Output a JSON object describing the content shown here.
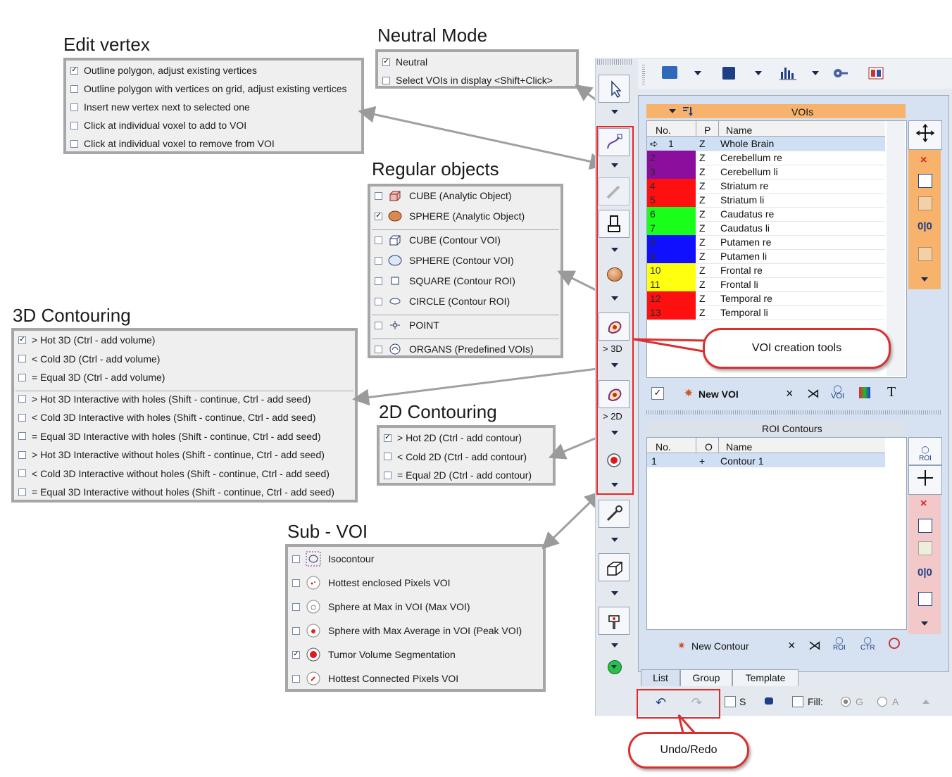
{
  "edit_vertex": {
    "title": "Edit vertex",
    "items": [
      {
        "label": "Outline polygon, adjust existing vertices",
        "checked": true
      },
      {
        "label": "Outline polygon with vertices on grid, adjust existing vertices",
        "checked": false
      },
      {
        "label": "Insert new vertex next to selected one",
        "checked": false
      },
      {
        "label": "Click at individual voxel to add to VOI",
        "checked": false
      },
      {
        "label": "Click at individual voxel to remove from VOI",
        "checked": false
      }
    ]
  },
  "neutral_mode": {
    "title": "Neutral Mode",
    "items": [
      {
        "label": "Neutral",
        "checked": true
      },
      {
        "label": "Select VOIs in display <Shift+Click>",
        "checked": false
      }
    ]
  },
  "regular_objects": {
    "title": "Regular objects",
    "items": [
      {
        "label": "CUBE (Analytic Object)",
        "checked": false,
        "icon": "cube-analytic-icon"
      },
      {
        "label": "SPHERE (Analytic Object)",
        "checked": true,
        "icon": "sphere-analytic-icon"
      },
      {
        "label": "CUBE (Contour VOI)",
        "checked": false,
        "icon": "cube-contour-icon"
      },
      {
        "label": "SPHERE (Contour VOI)",
        "checked": false,
        "icon": "sphere-contour-icon"
      },
      {
        "label": "SQUARE (Contour ROI)",
        "checked": false,
        "icon": "square-icon"
      },
      {
        "label": "CIRCLE (Contour ROI)",
        "checked": false,
        "icon": "circle-icon"
      },
      {
        "label": "POINT",
        "checked": false,
        "icon": "point-icon"
      },
      {
        "label": "ORGANS (Predefined VOIs)",
        "checked": false,
        "icon": "organs-icon"
      }
    ]
  },
  "contouring_3d": {
    "title": "3D Contouring",
    "items": [
      {
        "label": "> Hot 3D (Ctrl - add volume)",
        "checked": true
      },
      {
        "label": "< Cold 3D (Ctrl - add volume)",
        "checked": false
      },
      {
        "label": "= Equal 3D (Ctrl - add volume)",
        "checked": false
      },
      {
        "label": "> Hot 3D Interactive with holes (Shift - continue, Ctrl - add seed)",
        "checked": false
      },
      {
        "label": "< Cold 3D Interactive with holes (Shift - continue, Ctrl - add seed)",
        "checked": false
      },
      {
        "label": "= Equal 3D Interactive with holes (Shift - continue, Ctrl - add seed)",
        "checked": false
      },
      {
        "label": "> Hot 3D Interactive without holes (Shift - continue, Ctrl - add seed)",
        "checked": false
      },
      {
        "label": "< Cold 3D Interactive without holes (Shift - continue, Ctrl - add seed)",
        "checked": false
      },
      {
        "label": "= Equal 3D Interactive without holes (Shift - continue, Ctrl - add seed)",
        "checked": false
      }
    ]
  },
  "contouring_2d": {
    "title": "2D Contouring",
    "items": [
      {
        "label": "> Hot 2D (Ctrl - add contour)",
        "checked": true
      },
      {
        "label": "< Cold 2D (Ctrl - add contour)",
        "checked": false
      },
      {
        "label": "= Equal 2D (Ctrl - add contour)",
        "checked": false
      }
    ]
  },
  "sub_voi": {
    "title": "Sub - VOI",
    "items": [
      {
        "label": "Isocontour",
        "checked": false
      },
      {
        "label": "Hottest enclosed Pixels VOI",
        "checked": false
      },
      {
        "label": "Sphere at Max in VOI (Max VOI)",
        "checked": false
      },
      {
        "label": "Sphere with Max Average in VOI (Peak VOI)",
        "checked": false
      },
      {
        "label": "Tumor Volume Segmentation",
        "checked": true
      },
      {
        "label": "Hottest Connected Pixels VOI",
        "checked": false
      }
    ]
  },
  "toolbar": {
    "label_3d": "> 3D",
    "label_2d": "> 2D"
  },
  "vois": {
    "title": "VOIs",
    "columns": [
      "No.",
      "P",
      "Name"
    ],
    "rows": [
      {
        "no": "1",
        "p": "Z",
        "name": "Whole Brain",
        "color": "#ffffff"
      },
      {
        "no": "2",
        "p": "Z",
        "name": "Cerebellum re",
        "color": "#8b0f9c"
      },
      {
        "no": "3",
        "p": "Z",
        "name": "Cerebellum li",
        "color": "#8b0f9c"
      },
      {
        "no": "4",
        "p": "Z",
        "name": "Striatum re",
        "color": "#ff1010"
      },
      {
        "no": "5",
        "p": "Z",
        "name": "Striatum li",
        "color": "#ff1010"
      },
      {
        "no": "6",
        "p": "Z",
        "name": "Caudatus re",
        "color": "#1aff1a"
      },
      {
        "no": "7",
        "p": "Z",
        "name": "Caudatus li",
        "color": "#1aff1a"
      },
      {
        "no": "8",
        "p": "Z",
        "name": "Putamen re",
        "color": "#1010ff"
      },
      {
        "no": "9",
        "p": "Z",
        "name": "Putamen li",
        "color": "#1010ff"
      },
      {
        "no": "10",
        "p": "Z",
        "name": "Frontal re",
        "color": "#ffff10"
      },
      {
        "no": "11",
        "p": "Z",
        "name": "Frontal li",
        "color": "#ffff10"
      },
      {
        "no": "12",
        "p": "Z",
        "name": "Temporal re",
        "color": "#ff1010"
      },
      {
        "no": "13",
        "p": "Z",
        "name": "Temporal li",
        "color": "#ff1010"
      }
    ],
    "new_voi": "New VOI"
  },
  "roi": {
    "title": "ROI Contours",
    "columns": [
      "No.",
      "O",
      "Name"
    ],
    "rows": [
      {
        "no": "1",
        "o": "+",
        "name": "Contour 1"
      }
    ],
    "new_contour": "New Contour"
  },
  "tabs": [
    "List",
    "Group",
    "Template"
  ],
  "bottom": {
    "s_label": "S",
    "fill_label": "Fill:",
    "g_label": "G",
    "a_label": "A"
  },
  "callouts": {
    "voi_tools": "VOI creation tools",
    "undo_redo": "Undo/Redo"
  },
  "colors": {
    "highlight_red": "#e8262a",
    "header_orange": "#f7b26b",
    "selected_row": "#cfe0f5"
  }
}
